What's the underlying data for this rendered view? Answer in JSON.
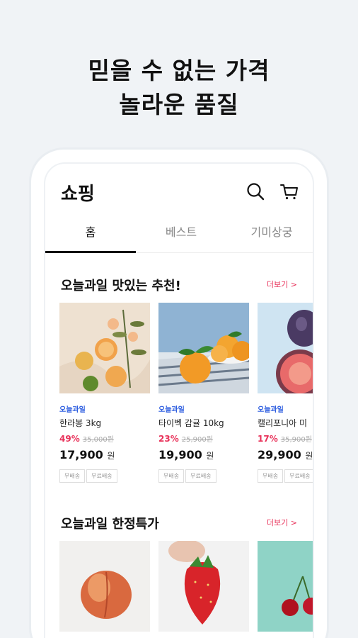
{
  "headline": {
    "line1": "믿을 수 없는 가격",
    "line2": "놀라운 품질"
  },
  "app": {
    "title": "쇼핑",
    "icons": [
      "search-icon",
      "cart-icon"
    ]
  },
  "tabs": [
    {
      "label": "홈",
      "active": true
    },
    {
      "label": "베스트",
      "active": false
    },
    {
      "label": "기미상궁",
      "active": false
    }
  ],
  "section1": {
    "title": "오늘과일 맛있는 추천!",
    "more": "더보기 >",
    "products": [
      {
        "brand": "오늘과일",
        "name": "한라봉 3kg",
        "discount": "49%",
        "original": "35,000원",
        "price": "17,900",
        "unit": "원",
        "tags": [
          "무배송",
          "무료배송"
        ]
      },
      {
        "brand": "오늘과일",
        "name": "타이벡 감귤 10kg",
        "discount": "23%",
        "original": "25,900원",
        "price": "19,900",
        "unit": "원",
        "tags": [
          "무배송",
          "무료배송"
        ]
      },
      {
        "brand": "오늘과일",
        "name": "캘리포니아 미",
        "discount": "17%",
        "original": "35,900원",
        "price": "29,900",
        "unit": "원",
        "tags": [
          "무배송",
          "무료배송"
        ]
      }
    ]
  },
  "section2": {
    "title": "오늘과일 한정특가",
    "more": "더보기 >"
  },
  "colors": {
    "accent": "#e8325a",
    "brand": "#2f5fe0",
    "background": "#f0f3f6"
  }
}
